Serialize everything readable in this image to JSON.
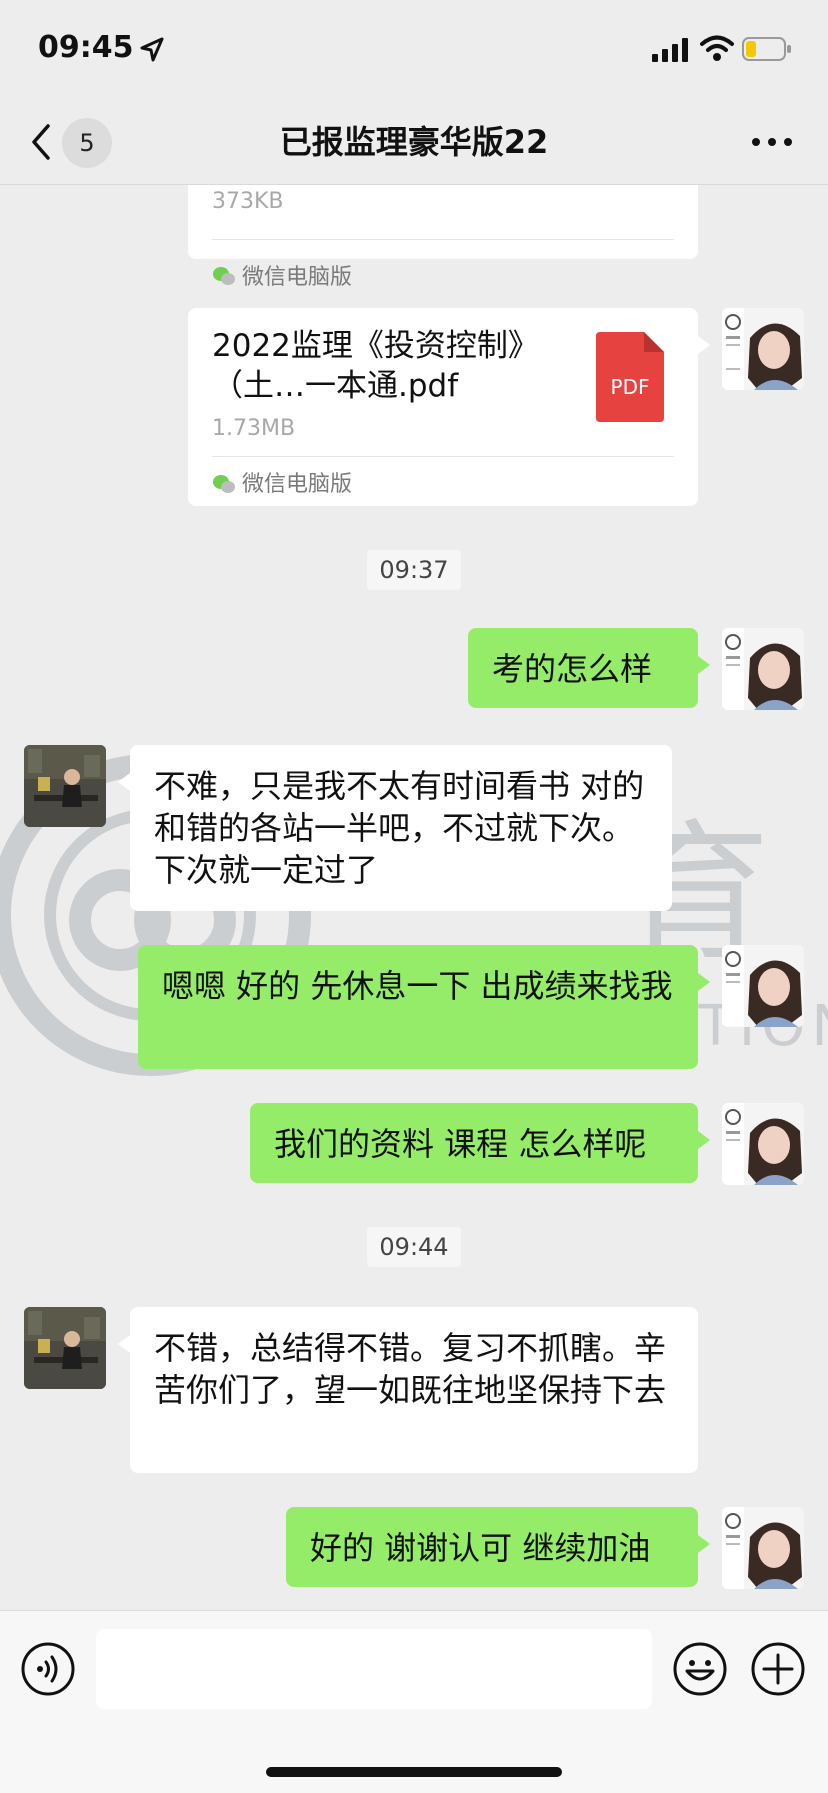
{
  "status_bar": {
    "time": "09:45"
  },
  "header": {
    "back_badge": "5",
    "title": "已报监理豪华版22"
  },
  "messages": {
    "file_1": {
      "size": "373KB",
      "source": "微信电脑版"
    },
    "file_2": {
      "name": "2022监理《投资控制》（土…一本通.pdf",
      "size": "1.73MB",
      "source": "微信电脑版",
      "icon_label": "PDF"
    },
    "time_1": "09:37",
    "msg_1": "考的怎么样",
    "msg_2": "不难，只是我不太有时间看书 对的和错的各站一半吧，不过就下次。下次就一定过了",
    "msg_3": "嗯嗯  好的  先休息一下   出成绩来找我",
    "msg_4": "我们的资料 课程 怎么样呢",
    "time_2": "09:44",
    "msg_5": "不错，总结得不错。复习不抓瞎。辛苦你们了，望一如既往地坚保持下去",
    "msg_6": "好的 谢谢认可 继续加油"
  },
  "watermark_text": "育",
  "watermark_subtext": "DALI EDUCATION",
  "colors": {
    "outgoing_bubble": "#95ec69",
    "incoming_bubble": "#ffffff",
    "background": "#ededed",
    "pdf_red": "#e64340"
  }
}
